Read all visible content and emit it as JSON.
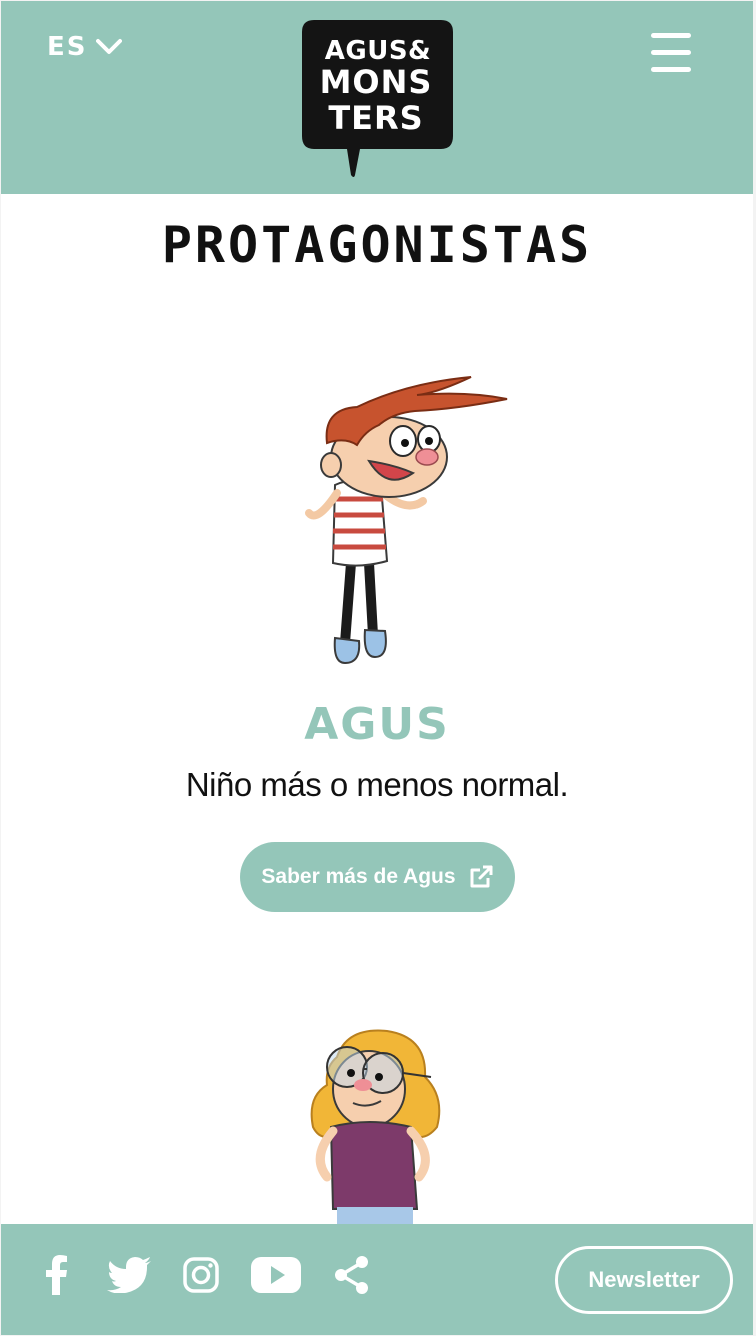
{
  "header": {
    "language": {
      "current": "ES",
      "icon": "chevron-down-icon"
    },
    "logo": {
      "lines": [
        "AGUS&",
        "MONS",
        "TERS"
      ]
    },
    "menu_icon": "hamburger-menu-icon"
  },
  "main": {
    "title": "PROTAGONISTAS",
    "characters": [
      {
        "name": "AGUS",
        "description": "Niño más o menos normal.",
        "button_label": "Saber más de Agus",
        "button_icon": "external-link-icon"
      }
    ]
  },
  "footer": {
    "social_icons": [
      "facebook-icon",
      "twitter-icon",
      "instagram-icon",
      "youtube-icon",
      "share-icon"
    ],
    "newsletter_label": "Newsletter"
  },
  "colors": {
    "brand": "#94c6b9",
    "text": "#111111",
    "background": "#ffffff"
  }
}
